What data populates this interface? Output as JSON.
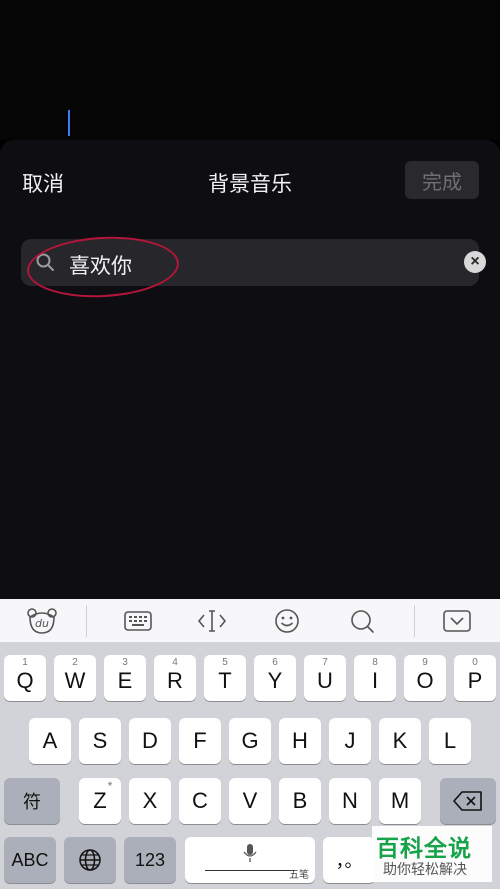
{
  "header": {
    "cancel_label": "取消",
    "title": "背景音乐",
    "done_label": "完成"
  },
  "search": {
    "value": "喜欢你",
    "clear_symbol": "×"
  },
  "toolbar": {
    "logo_text": "du",
    "icons": [
      "baidu-logo-icon",
      "keyboard-icon",
      "cursor-move-icon",
      "emoji-icon",
      "search-icon",
      "collapse-keyboard-icon"
    ]
  },
  "keyboard": {
    "row1": [
      {
        "num": "1",
        "label": "Q"
      },
      {
        "num": "2",
        "label": "W"
      },
      {
        "num": "3",
        "label": "E"
      },
      {
        "num": "4",
        "label": "R"
      },
      {
        "num": "5",
        "label": "T"
      },
      {
        "num": "6",
        "label": "Y"
      },
      {
        "num": "7",
        "label": "U"
      },
      {
        "num": "8",
        "label": "I"
      },
      {
        "num": "9",
        "label": "O"
      },
      {
        "num": "0",
        "label": "P"
      }
    ],
    "row2": [
      "A",
      "S",
      "D",
      "F",
      "G",
      "H",
      "J",
      "K",
      "L"
    ],
    "row3": [
      "Z",
      "X",
      "C",
      "V",
      "B",
      "N",
      "M"
    ],
    "row3_z_mark": "*",
    "symbol_key": "符",
    "abc_key": "ABC",
    "num_key": "123",
    "space_sub_label": "五笔",
    "punct_key": "，。"
  },
  "watermark": {
    "title": "百科全说",
    "subtitle": "助你轻松解决"
  }
}
